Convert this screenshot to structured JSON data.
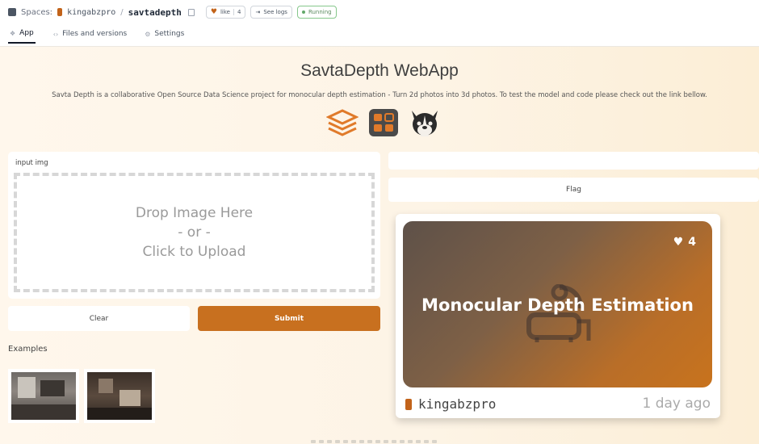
{
  "header": {
    "spaces_label": "Spaces:",
    "owner": "kingabzpro",
    "separator": "/",
    "repo": "savtadepth",
    "like_label": "like",
    "like_count": "4",
    "logs_label": "See logs",
    "status": "Running"
  },
  "tabs": [
    {
      "label": "App",
      "icon": "app-icon"
    },
    {
      "label": "Files and versions",
      "icon": "code-icon"
    },
    {
      "label": "Settings",
      "icon": "gear-icon"
    }
  ],
  "app": {
    "title": "SavtaDepth WebApp",
    "description": "Savta Depth is a collaborative Open Source Data Science project for monocular depth estimation - Turn 2d photos into 3d photos. To test the model and code please check out the link bellow.",
    "input_label": "input img",
    "drop_lines": [
      "Drop Image Here",
      "- or -",
      "Click to Upload"
    ],
    "clear_label": "Clear",
    "submit_label": "Submit",
    "examples_label": "Examples",
    "flag_label": "Flag"
  },
  "card": {
    "title": "Monocular Depth Estimation",
    "likes": "4",
    "owner": "kingabzpro",
    "time": "1 day ago"
  },
  "colors": {
    "accent": "#c8701f",
    "background": "#fdf8ee",
    "running_green": "#63a86a"
  }
}
